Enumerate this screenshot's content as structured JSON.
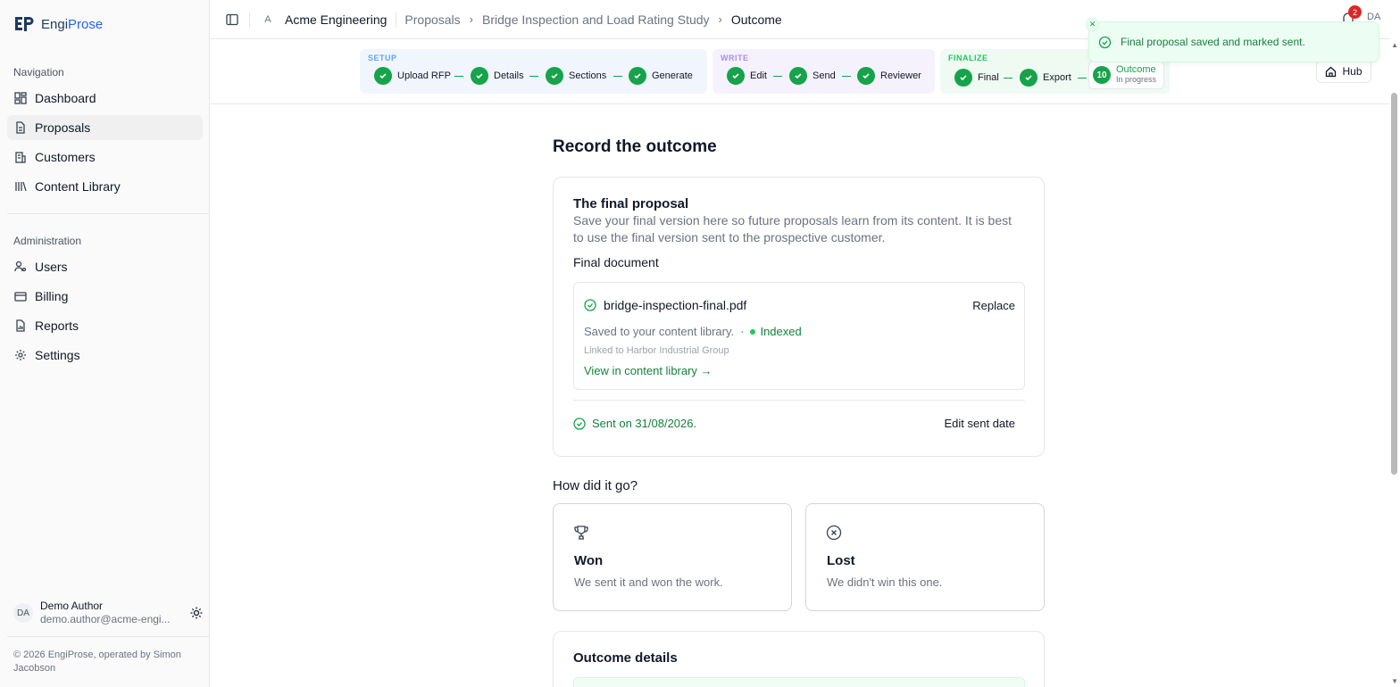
{
  "brand": {
    "name_a": "Engi",
    "name_b": "Prose"
  },
  "sidebar": {
    "nav_title": "Navigation",
    "nav": [
      {
        "label": "Dashboard",
        "icon": "dashboard-icon"
      },
      {
        "label": "Proposals",
        "icon": "document-icon",
        "active": true
      },
      {
        "label": "Customers",
        "icon": "building-icon"
      },
      {
        "label": "Content Library",
        "icon": "library-icon"
      }
    ],
    "admin_title": "Administration",
    "admin": [
      {
        "label": "Users",
        "icon": "users-icon"
      },
      {
        "label": "Billing",
        "icon": "credit-card-icon"
      },
      {
        "label": "Reports",
        "icon": "report-icon"
      },
      {
        "label": "Settings",
        "icon": "gear-icon"
      }
    ],
    "user": {
      "initials": "DA",
      "name": "Demo Author",
      "email": "demo.author@acme-engi..."
    },
    "footer": "© 2026 EngiProse, operated by Simon Jacobson"
  },
  "topbar": {
    "org_initial": "A",
    "org_name": "Acme Engineering",
    "breadcrumbs": [
      "Proposals",
      "Bridge Inspection and Load Rating Study",
      "Outcome"
    ],
    "notifications_count": "2",
    "user_initials": "DA",
    "hub_label": "Hub"
  },
  "stepper": {
    "groups": [
      {
        "label": "SETUP",
        "steps": [
          "Upload RFP",
          "Details",
          "Sections",
          "Generate"
        ]
      },
      {
        "label": "WRITE",
        "steps": [
          "Edit",
          "Send",
          "Reviewer"
        ]
      },
      {
        "label": "FINALIZE",
        "steps": [
          "Final",
          "Export"
        ],
        "current": {
          "number": "10",
          "label": "Outcome",
          "status": "In progress"
        }
      }
    ]
  },
  "toast": {
    "message": "Final proposal saved and marked sent."
  },
  "main": {
    "title": "Record the outcome",
    "final_card": {
      "title": "The final proposal",
      "description": "Save your final version here so future proposals learn from its content. It is best to use the final version sent to the prospective customer.",
      "doc_label": "Final document",
      "file_name": "bridge-inspection-final.pdf",
      "replace_label": "Replace",
      "saved_text": "Saved to your content library.",
      "separator": "·",
      "indexed_label": "Indexed",
      "linked_text": "Linked to Harbor Industrial Group",
      "view_link": "View in content library →",
      "sent_text": "Sent on 31/08/2026.",
      "edit_sent_label": "Edit sent date"
    },
    "how_title": "How did it go?",
    "outcomes": [
      {
        "title": "Won",
        "desc": "We sent it and won the work.",
        "icon": "trophy-icon"
      },
      {
        "title": "Lost",
        "desc": "We didn't win this one.",
        "icon": "x-circle-icon"
      }
    ],
    "details_title": "Outcome details"
  },
  "colors": {
    "accent_green": "#16a34a",
    "brand_blue": "#2563eb",
    "badge_red": "#dc2626"
  }
}
